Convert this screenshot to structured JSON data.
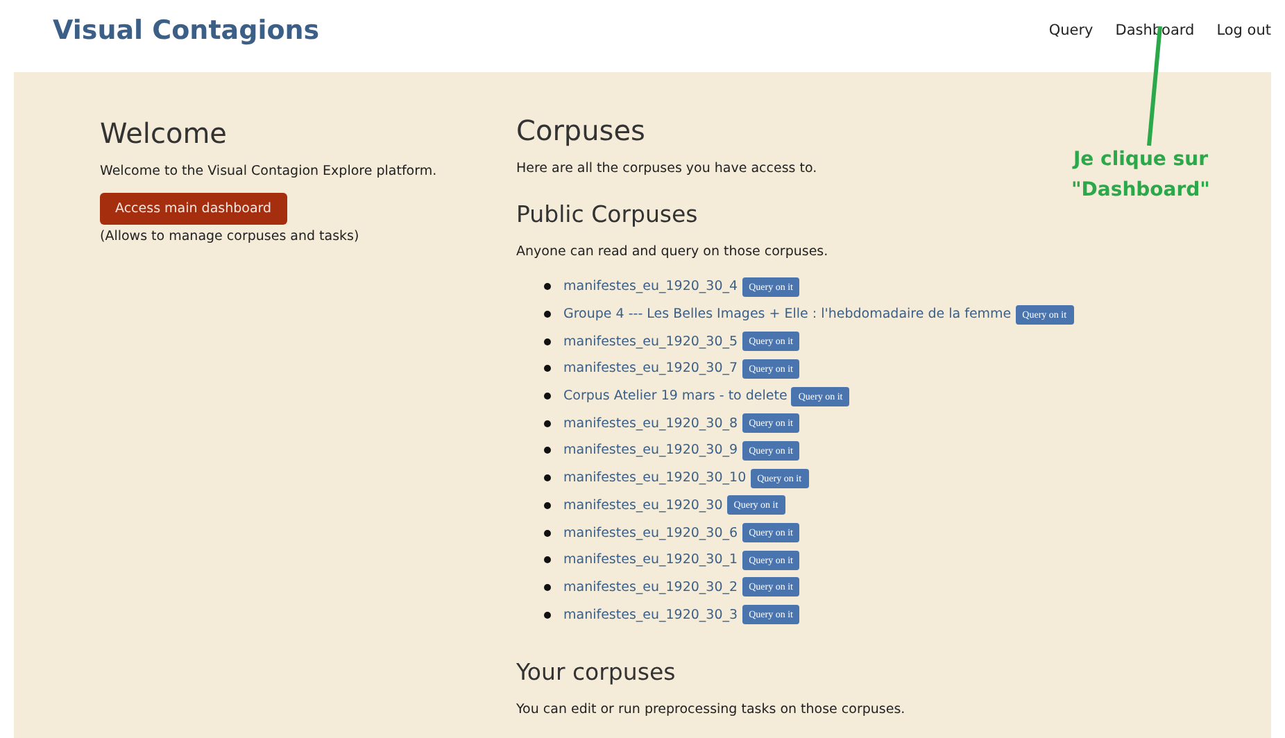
{
  "header": {
    "title": "Visual Contagions",
    "nav": [
      "Query",
      "Dashboard",
      "Log out"
    ]
  },
  "welcome": {
    "heading": "Welcome",
    "text": "Welcome to the Visual Contagion Explore platform.",
    "button": "Access main dashboard",
    "note": "(Allows to manage corpuses and tasks)"
  },
  "corpuses": {
    "heading": "Corpuses",
    "text": "Here are all the corpuses you have access to.",
    "public": {
      "heading": "Public Corpuses",
      "text": "Anyone can read and query on those corpuses.",
      "items": [
        {
          "name": "manifestes_eu_1920_30_4",
          "button": "Query on it"
        },
        {
          "name": "Groupe 4 --- Les Belles Images + Elle : l'hebdomadaire de la femme",
          "button": "Query on it"
        },
        {
          "name": "manifestes_eu_1920_30_5",
          "button": "Query on it"
        },
        {
          "name": "manifestes_eu_1920_30_7",
          "button": "Query on it"
        },
        {
          "name": "Corpus Atelier 19 mars - to delete",
          "button": "Query on it"
        },
        {
          "name": "manifestes_eu_1920_30_8",
          "button": "Query on it"
        },
        {
          "name": "manifestes_eu_1920_30_9",
          "button": "Query on it"
        },
        {
          "name": "manifestes_eu_1920_30_10",
          "button": "Query on it"
        },
        {
          "name": "manifestes_eu_1920_30",
          "button": "Query on it"
        },
        {
          "name": "manifestes_eu_1920_30_6",
          "button": "Query on it"
        },
        {
          "name": "manifestes_eu_1920_30_1",
          "button": "Query on it"
        },
        {
          "name": "manifestes_eu_1920_30_2",
          "button": "Query on it"
        },
        {
          "name": "manifestes_eu_1920_30_3",
          "button": "Query on it"
        }
      ]
    },
    "yours": {
      "heading": "Your corpuses",
      "text": "You can edit or run preprocessing tasks on those corpuses."
    }
  },
  "annotation": {
    "lines": [
      "Je clique sur",
      "\"Dashboard\""
    ]
  }
}
